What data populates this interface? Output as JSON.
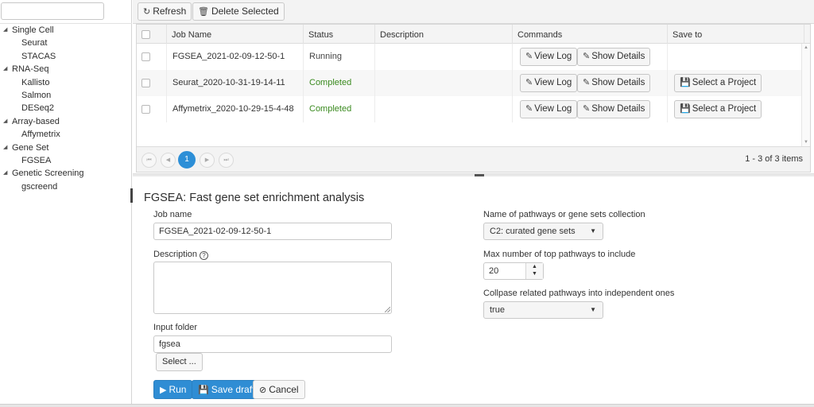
{
  "sidebar": {
    "search": {
      "value": "",
      "placeholder": ""
    },
    "tree": [
      {
        "type": "parent",
        "label": "Single Cell"
      },
      {
        "type": "child",
        "label": "Seurat"
      },
      {
        "type": "child",
        "label": "STACAS"
      },
      {
        "type": "parent",
        "label": "RNA-Seq"
      },
      {
        "type": "child",
        "label": "Kallisto"
      },
      {
        "type": "child",
        "label": "Salmon"
      },
      {
        "type": "child",
        "label": "DESeq2"
      },
      {
        "type": "parent",
        "label": "Array-based"
      },
      {
        "type": "child",
        "label": "Affymetrix"
      },
      {
        "type": "parent",
        "label": "Gene Set"
      },
      {
        "type": "child",
        "label": "FGSEA"
      },
      {
        "type": "parent",
        "label": "Genetic Screening"
      },
      {
        "type": "child",
        "label": "gscreend"
      }
    ],
    "toggle_icon": "◢"
  },
  "toolbar": {
    "refresh_label": "Refresh",
    "refresh_icon": "↻",
    "delete_label": "Delete Selected",
    "delete_icon": "🗑"
  },
  "grid": {
    "columns": {
      "job_name": "Job Name",
      "status": "Status",
      "description": "Description",
      "commands": "Commands",
      "save_to": "Save to"
    },
    "rows": [
      {
        "job_name": "FGSEA_2021-02-09-12-50-1",
        "status": "Running",
        "description": "",
        "view_log": "View Log",
        "show_details": "Show Details",
        "save_to": ""
      },
      {
        "job_name": "Seurat_2020-10-31-19-14-11",
        "status": "Completed",
        "description": "",
        "view_log": "View Log",
        "show_details": "Show Details",
        "save_to": "Select a Project"
      },
      {
        "job_name": "Affymetrix_2020-10-29-15-4-48",
        "status": "Completed",
        "description": "",
        "view_log": "View Log",
        "show_details": "Show Details",
        "save_to": "Select a Project"
      }
    ],
    "edit_icon": "✎",
    "save_icon": "💾"
  },
  "pager": {
    "current_page": "1",
    "first_icon": "⏮",
    "prev_icon": "◀",
    "next_icon": "▶",
    "last_icon": "⏭",
    "info": "1 - 3 of 3 items"
  },
  "form": {
    "title": "FGSEA: Fast gene set enrichment analysis",
    "job_name_label": "Job name",
    "job_name_value": "FGSEA_2021-02-09-12-50-1",
    "description_label": "Description",
    "description_value": "",
    "input_folder_label": "Input folder",
    "input_folder_value": "fgsea",
    "select_button": "Select ...",
    "collection_label": "Name of pathways or gene sets collection",
    "collection_value": "C2: curated gene sets",
    "max_pathways_label": "Max number of top pathways to include",
    "max_pathways_value": "20",
    "collapse_label": "Collpase related pathways into independent ones",
    "collapse_value": "true",
    "run_label": "Run",
    "save_draft_label": "Save draft",
    "cancel_label": "Cancel"
  }
}
